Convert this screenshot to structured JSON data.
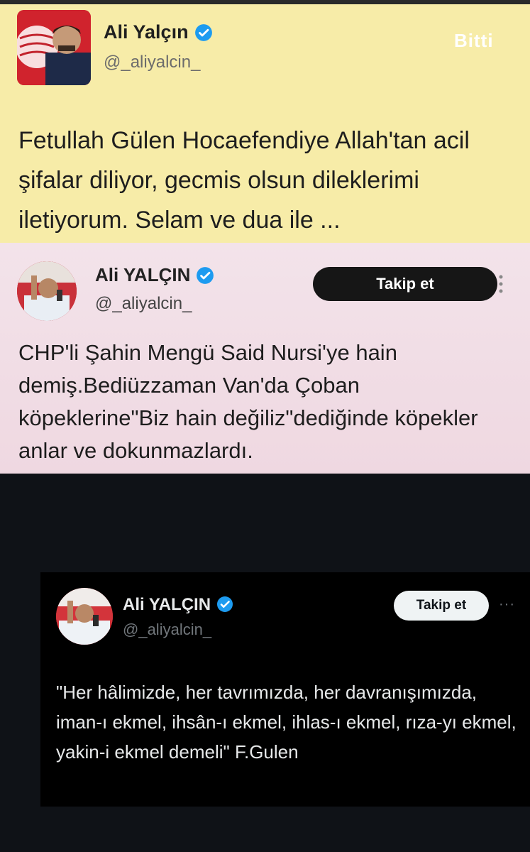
{
  "panel_yellow": {
    "name": "Ali Yalçın",
    "handle": "@_aliyalcin_",
    "overlay_label": "Bitti",
    "text": "Fetullah Gülen Hocaefendiye Allah'tan acil şifalar diliyor, gecmis olsun dileklerimi iletiyorum. Selam ve dua ile ...",
    "background_color": "#f7eca8"
  },
  "panel_pink": {
    "name": "Ali YALÇIN",
    "handle": "@_aliyalcin_",
    "follow_label": "Takip et",
    "text": "CHP'li Şahin Mengü Said Nursi'ye hain demiş.Bediüzzaman Van'da Çoban köpeklerine\"Biz hain değiliz\"dediğinde köpekler anlar ve dokunmazlardı.",
    "background_color": "#f1dee6"
  },
  "panel_dark": {
    "name": "Ali YALÇIN",
    "handle": "@_aliyalcin_",
    "follow_label": "Takip et",
    "more_label": "···",
    "text": "\"Her hâlimizde, her tavrımızda, her davranışımızda, iman-ı ekmel, ihsân-ı ekmel, ihlas-ı ekmel, rıza-yı ekmel, yakin-i ekmel demeli\" F.Gulen",
    "background_color": "#000000"
  },
  "icons": {
    "verified": "verified-badge-icon",
    "more": "more-options-icon"
  },
  "colors": {
    "verified_blue": "#1d9bf0",
    "page_background": "#0f1217"
  }
}
